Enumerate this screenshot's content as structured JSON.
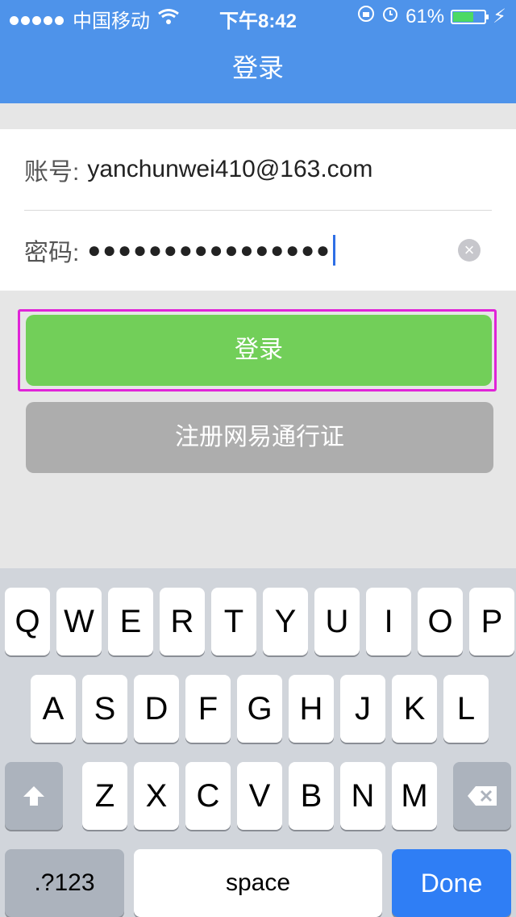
{
  "status": {
    "carrier": "中国移动",
    "time": "下午8:42",
    "battery_percent": "61%",
    "battery_level": 0.61
  },
  "nav": {
    "title": "登录"
  },
  "form": {
    "account_label": "账号:",
    "account_value": "yanchunwei410@163.com",
    "password_label": "密码:",
    "password_value": "●●●●●●●●●●●●●●●●"
  },
  "buttons": {
    "login": "登录",
    "register": "注册网易通行证"
  },
  "keyboard": {
    "row1": [
      "Q",
      "W",
      "E",
      "R",
      "T",
      "Y",
      "U",
      "I",
      "O",
      "P"
    ],
    "row2": [
      "A",
      "S",
      "D",
      "F",
      "G",
      "H",
      "J",
      "K",
      "L"
    ],
    "row3": [
      "Z",
      "X",
      "C",
      "V",
      "B",
      "N",
      "M"
    ],
    "numbers": ".?123",
    "space": "space",
    "done": "Done"
  },
  "colors": {
    "nav": "#4e93ea",
    "login_button": "#72cf59",
    "register_button": "#adadad",
    "highlight": "#e024d8"
  }
}
